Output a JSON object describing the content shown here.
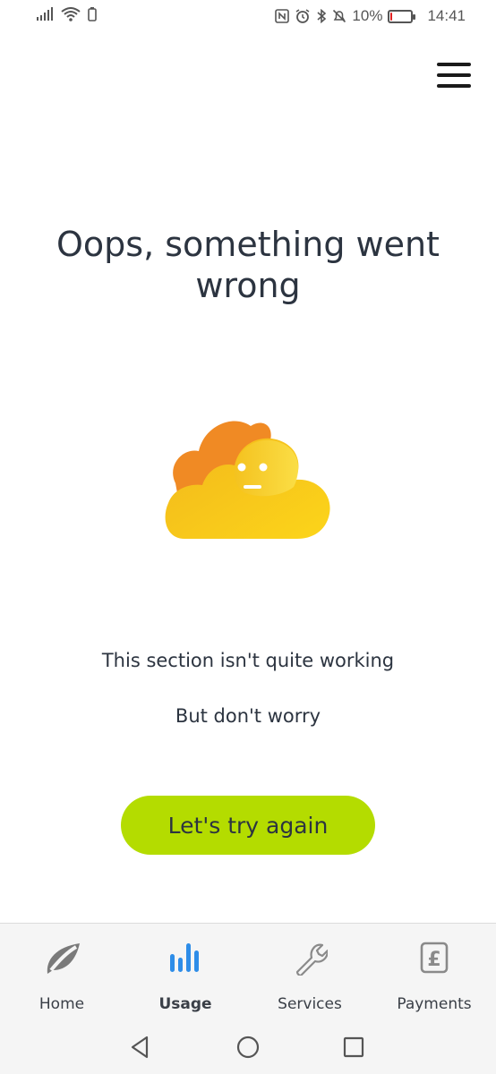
{
  "status_bar": {
    "battery_percent": "10%",
    "time": "14:41",
    "battery_level": 0.1,
    "battery_color": "#e02020"
  },
  "error": {
    "title": "Oops, something went wrong",
    "message": "This section isn't quite working",
    "submessage": "But don't worry",
    "retry_label": "Let's try again"
  },
  "colors": {
    "accent": "#b4dc00",
    "active_tab": "#2e8de8",
    "cloud_orange": "#f08a24",
    "cloud_yellow": "#f6c21a"
  },
  "tabs": [
    {
      "label": "Home",
      "icon": "leaf-icon",
      "active": false
    },
    {
      "label": "Usage",
      "icon": "bar-chart-icon",
      "active": true
    },
    {
      "label": "Services",
      "icon": "wrench-icon",
      "active": false
    },
    {
      "label": "Payments",
      "icon": "pound-icon",
      "active": false
    }
  ],
  "system_nav": [
    "back-icon",
    "home-circle-icon",
    "recents-square-icon"
  ]
}
